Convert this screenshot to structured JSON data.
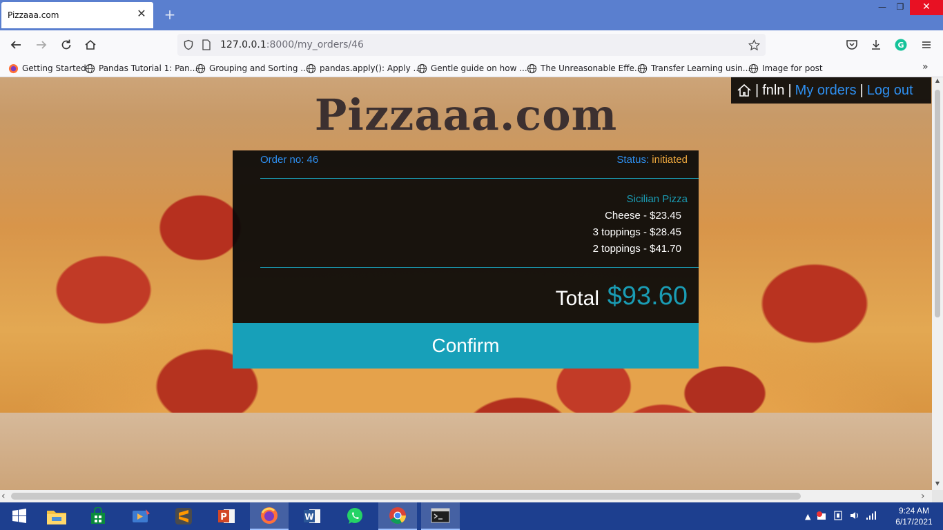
{
  "browser": {
    "tab_title": "Pizzaaa.com",
    "tab_close": "✕",
    "new_tab": "+",
    "url_host": "127.0.0.1",
    "url_rest": ":8000/my_orders/46",
    "window": {
      "minimize": "—",
      "maximize": "❐",
      "close": "✕"
    }
  },
  "bookmarks": [
    {
      "label": "Getting Started",
      "icon": "firefox-icon"
    },
    {
      "label": "Pandas Tutorial 1: Pan...",
      "icon": "globe-icon"
    },
    {
      "label": "Grouping and Sorting ...",
      "icon": "globe-icon"
    },
    {
      "label": "pandas.apply(): Apply ...",
      "icon": "globe-icon"
    },
    {
      "label": "Gentle guide on how ...",
      "icon": "globe-icon"
    },
    {
      "label": "The Unreasonable Effe...",
      "icon": "globe-icon"
    },
    {
      "label": "Transfer Learning usin...",
      "icon": "globe-icon"
    },
    {
      "label": "Image for post",
      "icon": "globe-icon"
    }
  ],
  "site": {
    "title": "Pizzaaa.com",
    "nav": {
      "user": "fnln",
      "separator": "|",
      "my_orders": "My orders",
      "log_out": "Log out"
    }
  },
  "order": {
    "number_label": "Order no: 46",
    "status_label": "Status:",
    "status_value": "initiated",
    "item_name": "Sicilian Pizza",
    "lines": [
      "Cheese - $23.45",
      "3 toppings - $28.45",
      "2 toppings - $41.70"
    ],
    "total_label": "Total",
    "total_value": "$93.60",
    "confirm_label": "Confirm"
  },
  "taskbar": {
    "apps": [
      "start",
      "file-explorer",
      "microsoft-store",
      "media-player",
      "sublime-text",
      "powerpoint",
      "firefox",
      "word",
      "whatsapp",
      "chrome",
      "terminal"
    ],
    "time": "9:24 AM",
    "date": "6/17/2021"
  },
  "colors": {
    "accent_teal": "#17a0b9",
    "link_blue": "#2e8ff0",
    "status_orange": "#f0a93e",
    "taskbar": "#1d3f8f"
  }
}
